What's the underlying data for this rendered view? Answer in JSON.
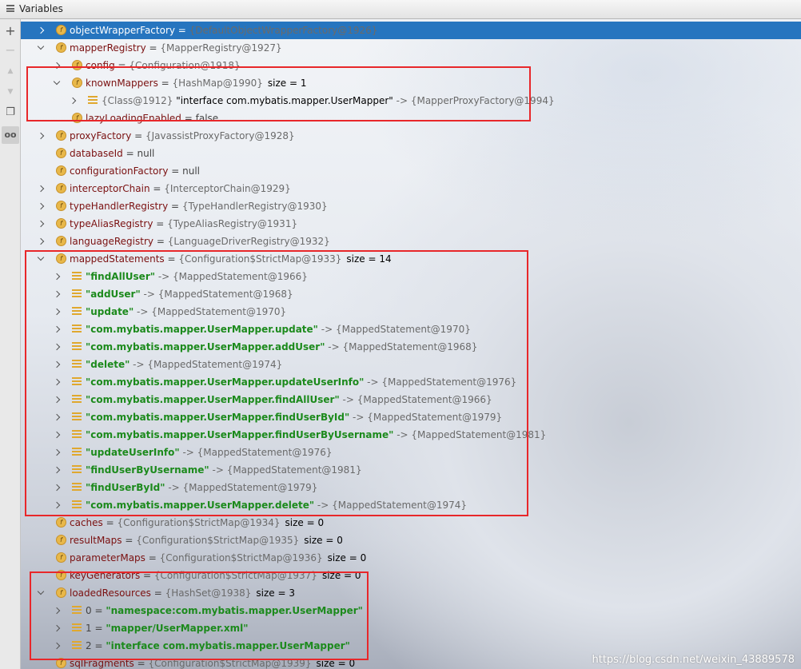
{
  "panel": {
    "title": "Variables"
  },
  "toolbar": {
    "add": "+",
    "remove": "−",
    "up": "▲",
    "down": "▼",
    "copy": "❐",
    "glasses": "oo"
  },
  "rows": [
    {
      "depth": 0,
      "arrow": "collapsed",
      "icon": "field",
      "name": "objectWrapperFactory",
      "eq": " = ",
      "ref": "{DefaultObjectWrapperFactory@1926}",
      "selected": true
    },
    {
      "depth": 0,
      "arrow": "expanded",
      "icon": "field",
      "name": "mapperRegistry",
      "eq": " = ",
      "ref": "{MapperRegistry@1927}"
    },
    {
      "depth": 1,
      "arrow": "collapsed",
      "icon": "field",
      "name": "config",
      "eq": " = ",
      "ref": "{Configuration@1918}"
    },
    {
      "depth": 1,
      "arrow": "expanded",
      "icon": "field",
      "name": "knownMappers",
      "eq": " = ",
      "ref": "{HashMap@1990}",
      "size": "size = 1"
    },
    {
      "depth": 2,
      "arrow": "collapsed",
      "icon": "entry",
      "pre": "",
      "ref": "{Class@1912}",
      "str": "\"interface com.mybatis.mapper.UserMapper\"",
      "post": " -> ",
      "ref2": "{MapperProxyFactory@1994}",
      "plainstr": true
    },
    {
      "depth": 1,
      "arrow": "none",
      "icon": "field",
      "name": "lazyLoadingEnabled",
      "eq": " = ",
      "val": "false"
    },
    {
      "depth": 0,
      "arrow": "collapsed",
      "icon": "field",
      "name": "proxyFactory",
      "eq": " = ",
      "ref": "{JavassistProxyFactory@1928}"
    },
    {
      "depth": 0,
      "arrow": "none",
      "icon": "field",
      "name": "databaseId",
      "eq": " = ",
      "val": "null"
    },
    {
      "depth": 0,
      "arrow": "none",
      "icon": "field",
      "name": "configurationFactory",
      "eq": " = ",
      "val": "null"
    },
    {
      "depth": 0,
      "arrow": "collapsed",
      "icon": "field",
      "name": "interceptorChain",
      "eq": " = ",
      "ref": "{InterceptorChain@1929}"
    },
    {
      "depth": 0,
      "arrow": "collapsed",
      "icon": "field",
      "name": "typeHandlerRegistry",
      "eq": " = ",
      "ref": "{TypeHandlerRegistry@1930}"
    },
    {
      "depth": 0,
      "arrow": "collapsed",
      "icon": "field",
      "name": "typeAliasRegistry",
      "eq": " = ",
      "ref": "{TypeAliasRegistry@1931}"
    },
    {
      "depth": 0,
      "arrow": "collapsed",
      "icon": "field",
      "name": "languageRegistry",
      "eq": " = ",
      "ref": "{LanguageDriverRegistry@1932}"
    },
    {
      "depth": 0,
      "arrow": "expanded",
      "icon": "field",
      "name": "mappedStatements",
      "eq": " = ",
      "ref": "{Configuration$StrictMap@1933}",
      "size": "size = 14"
    },
    {
      "depth": 1,
      "arrow": "collapsed",
      "icon": "entry",
      "str": "\"findAllUser\"",
      "post": " -> ",
      "ref2": "{MappedStatement@1966}"
    },
    {
      "depth": 1,
      "arrow": "collapsed",
      "icon": "entry",
      "str": "\"addUser\"",
      "post": " -> ",
      "ref2": "{MappedStatement@1968}"
    },
    {
      "depth": 1,
      "arrow": "collapsed",
      "icon": "entry",
      "str": "\"update\"",
      "post": " -> ",
      "ref2": "{MappedStatement@1970}"
    },
    {
      "depth": 1,
      "arrow": "collapsed",
      "icon": "entry",
      "str": "\"com.mybatis.mapper.UserMapper.update\"",
      "post": " -> ",
      "ref2": "{MappedStatement@1970}"
    },
    {
      "depth": 1,
      "arrow": "collapsed",
      "icon": "entry",
      "str": "\"com.mybatis.mapper.UserMapper.addUser\"",
      "post": " -> ",
      "ref2": "{MappedStatement@1968}"
    },
    {
      "depth": 1,
      "arrow": "collapsed",
      "icon": "entry",
      "str": "\"delete\"",
      "post": " -> ",
      "ref2": "{MappedStatement@1974}"
    },
    {
      "depth": 1,
      "arrow": "collapsed",
      "icon": "entry",
      "str": "\"com.mybatis.mapper.UserMapper.updateUserInfo\"",
      "post": " -> ",
      "ref2": "{MappedStatement@1976}"
    },
    {
      "depth": 1,
      "arrow": "collapsed",
      "icon": "entry",
      "str": "\"com.mybatis.mapper.UserMapper.findAllUser\"",
      "post": " -> ",
      "ref2": "{MappedStatement@1966}"
    },
    {
      "depth": 1,
      "arrow": "collapsed",
      "icon": "entry",
      "str": "\"com.mybatis.mapper.UserMapper.findUserById\"",
      "post": " -> ",
      "ref2": "{MappedStatement@1979}"
    },
    {
      "depth": 1,
      "arrow": "collapsed",
      "icon": "entry",
      "str": "\"com.mybatis.mapper.UserMapper.findUserByUsername\"",
      "post": " -> ",
      "ref2": "{MappedStatement@1981}"
    },
    {
      "depth": 1,
      "arrow": "collapsed",
      "icon": "entry",
      "str": "\"updateUserInfo\"",
      "post": " -> ",
      "ref2": "{MappedStatement@1976}"
    },
    {
      "depth": 1,
      "arrow": "collapsed",
      "icon": "entry",
      "str": "\"findUserByUsername\"",
      "post": " -> ",
      "ref2": "{MappedStatement@1981}"
    },
    {
      "depth": 1,
      "arrow": "collapsed",
      "icon": "entry",
      "str": "\"findUserById\"",
      "post": " -> ",
      "ref2": "{MappedStatement@1979}"
    },
    {
      "depth": 1,
      "arrow": "collapsed",
      "icon": "entry",
      "str": "\"com.mybatis.mapper.UserMapper.delete\"",
      "post": " -> ",
      "ref2": "{MappedStatement@1974}"
    },
    {
      "depth": 0,
      "arrow": "none",
      "icon": "field",
      "name": "caches",
      "eq": " = ",
      "ref": "{Configuration$StrictMap@1934}",
      "size": "size = 0"
    },
    {
      "depth": 0,
      "arrow": "none",
      "icon": "field",
      "name": "resultMaps",
      "eq": " = ",
      "ref": "{Configuration$StrictMap@1935}",
      "size": "size = 0"
    },
    {
      "depth": 0,
      "arrow": "none",
      "icon": "field",
      "name": "parameterMaps",
      "eq": " = ",
      "ref": "{Configuration$StrictMap@1936}",
      "size": "size = 0"
    },
    {
      "depth": 0,
      "arrow": "none",
      "icon": "field",
      "name": "keyGenerators",
      "eq": " = ",
      "ref": "{Configuration$StrictMap@1937}",
      "size": "size = 0"
    },
    {
      "depth": 0,
      "arrow": "expanded",
      "icon": "field",
      "name": "loadedResources",
      "eq": " = ",
      "ref": "{HashSet@1938}",
      "size": "size = 3"
    },
    {
      "depth": 1,
      "arrow": "collapsed",
      "icon": "entry",
      "pre": "0 = ",
      "str": "\"namespace:com.mybatis.mapper.UserMapper\""
    },
    {
      "depth": 1,
      "arrow": "collapsed",
      "icon": "entry",
      "pre": "1 = ",
      "str": "\"mapper/UserMapper.xml\""
    },
    {
      "depth": 1,
      "arrow": "collapsed",
      "icon": "entry",
      "pre": "2 = ",
      "str": "\"interface com.mybatis.mapper.UserMapper\""
    },
    {
      "depth": 0,
      "arrow": "none",
      "icon": "field",
      "name": "sqlFragments",
      "eq": " = ",
      "ref": "{Configuration$StrictMap@1939}",
      "size": "size = 0"
    }
  ],
  "watermark": "https://blog.csdn.net/weixin_43889578"
}
